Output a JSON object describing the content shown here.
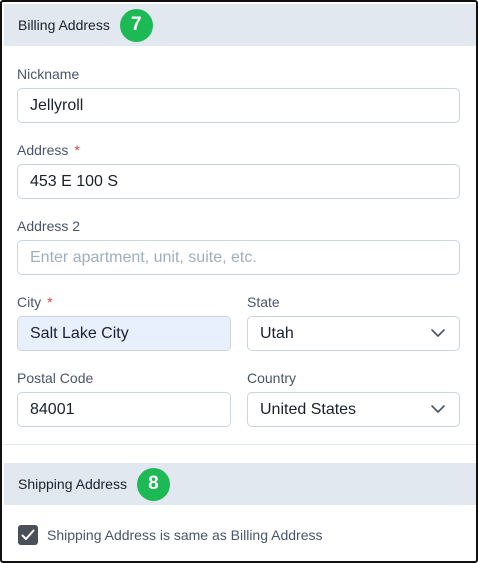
{
  "billing": {
    "title": "Billing Address",
    "step": "7",
    "nickname": {
      "label": "Nickname",
      "value": "Jellyroll"
    },
    "address": {
      "label": "Address",
      "required_mark": "*",
      "value": "453 E 100 S"
    },
    "address2": {
      "label": "Address 2",
      "placeholder": "Enter apartment, unit, suite, etc.",
      "value": ""
    },
    "city": {
      "label": "City",
      "required_mark": "*",
      "value": "Salt Lake City"
    },
    "state": {
      "label": "State",
      "value": "Utah"
    },
    "postal": {
      "label": "Postal Code",
      "value": "84001"
    },
    "country": {
      "label": "Country",
      "value": "United States"
    }
  },
  "shipping": {
    "title": "Shipping Address",
    "step": "8",
    "same_as_billing": {
      "label": "Shipping Address is same as Billing Address",
      "checked": true
    }
  },
  "colors": {
    "step_badge": "#1db954",
    "section_header": "#e2e8f0",
    "required": "#e53e3e",
    "autofill": "#e8f0fe"
  }
}
